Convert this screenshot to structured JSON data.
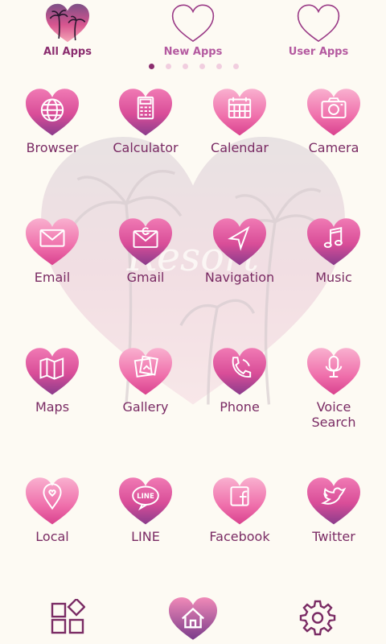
{
  "tabs": [
    {
      "label": "All Apps",
      "icon": "palm-heart-icon",
      "active": true
    },
    {
      "label": "New Apps",
      "icon": "heart-outline-icon",
      "active": false
    },
    {
      "label": "User Apps",
      "icon": "heart-outline-icon",
      "active": false
    }
  ],
  "pager": {
    "count": 6,
    "active": 1
  },
  "apps": [
    {
      "label": "Browser",
      "icon": "globe-icon"
    },
    {
      "label": "Calculator",
      "icon": "calculator-icon"
    },
    {
      "label": "Calendar",
      "icon": "calendar-icon"
    },
    {
      "label": "Camera",
      "icon": "camera-icon"
    },
    {
      "label": "Email",
      "icon": "envelope-icon"
    },
    {
      "label": "Gmail",
      "icon": "gmail-envelope-icon"
    },
    {
      "label": "Navigation",
      "icon": "navigation-arrow-icon"
    },
    {
      "label": "Music",
      "icon": "music-note-icon"
    },
    {
      "label": "Maps",
      "icon": "map-icon"
    },
    {
      "label": "Gallery",
      "icon": "gallery-icon"
    },
    {
      "label": "Phone",
      "icon": "phone-icon"
    },
    {
      "label": "Voice\nSearch",
      "icon": "microphone-icon"
    },
    {
      "label": "Local",
      "icon": "location-pin-icon"
    },
    {
      "label": "LINE",
      "icon": "line-bubble-icon"
    },
    {
      "label": "Facebook",
      "icon": "facebook-icon"
    },
    {
      "label": "Twitter",
      "icon": "twitter-bird-icon"
    }
  ],
  "dock": [
    {
      "icon": "widgets-icon"
    },
    {
      "icon": "home-heart-icon"
    },
    {
      "icon": "settings-gear-icon"
    }
  ],
  "colors": {
    "accent": "#8b2d6f",
    "label": "#7a2b64",
    "inactive_tab": "#b45aa0",
    "background": "#fdfaf3"
  }
}
